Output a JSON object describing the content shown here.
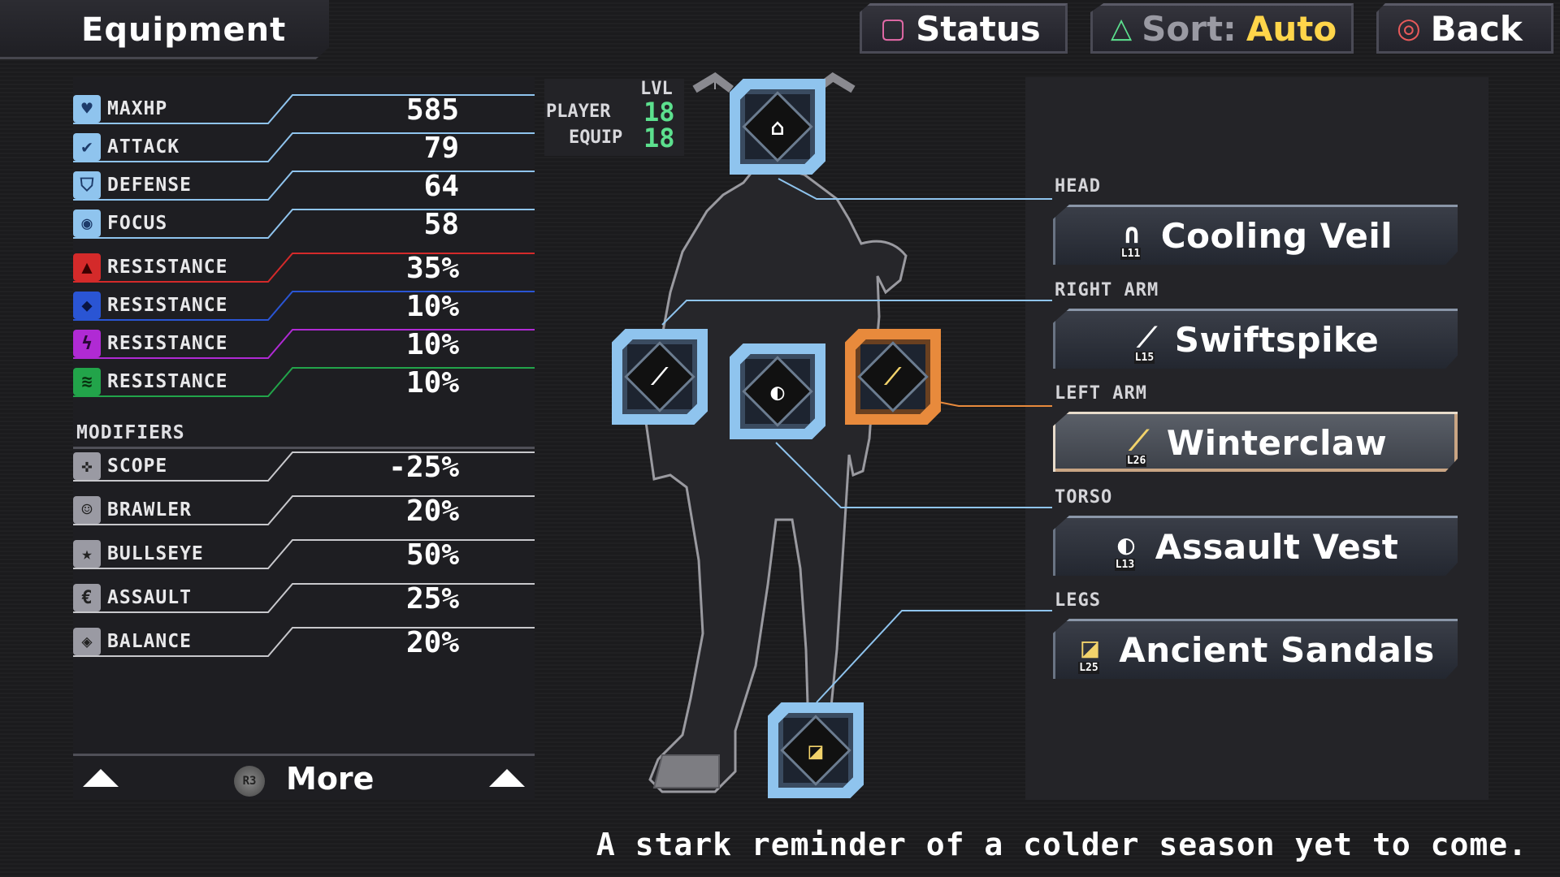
{
  "header": {
    "title": "Equipment",
    "buttons": [
      {
        "symbol": "square",
        "label": "Status"
      },
      {
        "symbol": "triangle",
        "label": "Sort:",
        "value": "Auto"
      },
      {
        "symbol": "circle",
        "label": "Back"
      }
    ]
  },
  "stats": [
    {
      "icon": "heart-icon",
      "label": "MAXHP",
      "value": "585",
      "color": "#8fc4ee"
    },
    {
      "icon": "sword-icon",
      "label": "ATTACK",
      "value": "79",
      "color": "#8fc4ee"
    },
    {
      "icon": "shield-icon",
      "label": "DEFENSE",
      "value": "64",
      "color": "#8fc4ee"
    },
    {
      "icon": "eye-icon",
      "label": "FOCUS",
      "value": "58",
      "color": "#8fc4ee"
    },
    {
      "icon": "fire-icon",
      "label": "RESISTANCE",
      "value": "35%",
      "color": "#d42a2a"
    },
    {
      "icon": "frost-icon",
      "label": "RESISTANCE",
      "value": "10%",
      "color": "#2a55d4"
    },
    {
      "icon": "lightning-icon",
      "label": "RESISTANCE",
      "value": "10%",
      "color": "#b02ad4"
    },
    {
      "icon": "wind-icon",
      "label": "RESISTANCE",
      "value": "10%",
      "color": "#22a44a"
    }
  ],
  "modifiers": {
    "header": "MODIFIERS",
    "items": [
      {
        "icon": "scope-icon",
        "label": "SCOPE",
        "value": "-25%"
      },
      {
        "icon": "fist-icon",
        "label": "BRAWLER",
        "value": "20%"
      },
      {
        "icon": "star-icon",
        "label": "BULLSEYE",
        "value": "50%"
      },
      {
        "icon": "assault-icon",
        "label": "ASSAULT",
        "value": "25%"
      },
      {
        "icon": "balance-icon",
        "label": "BALANCE",
        "value": "20%"
      }
    ]
  },
  "more": {
    "button": "R3",
    "label": "More"
  },
  "level": {
    "header": "LVL",
    "player_label": "PLAYER",
    "player_value": "18",
    "equip_label": "EQUIP",
    "equip_value": "18"
  },
  "slots": {
    "head": {
      "category": "HEAD",
      "name": "Cooling Veil",
      "level": "L11",
      "icon": "helmet-icon"
    },
    "right_arm": {
      "category": "RIGHT ARM",
      "name": "Swiftspike",
      "level": "L15",
      "icon": "arm-icon"
    },
    "left_arm": {
      "category": "LEFT ARM",
      "name": "Winterclaw",
      "level": "L26",
      "icon": "arm-icon"
    },
    "torso": {
      "category": "TORSO",
      "name": "Assault Vest",
      "level": "L13",
      "icon": "vest-icon"
    },
    "legs": {
      "category": "LEGS",
      "name": "Ancient Sandals",
      "level": "L25",
      "icon": "boot-icon"
    }
  },
  "selected_slot": "left_arm",
  "description": "A stark reminder of a colder season yet to come.",
  "colors": {
    "accent_blue": "#8fc4ee",
    "accent_orange": "#e88a3c",
    "level_green": "#5ce08e",
    "sort_yellow": "#ffd54a"
  }
}
